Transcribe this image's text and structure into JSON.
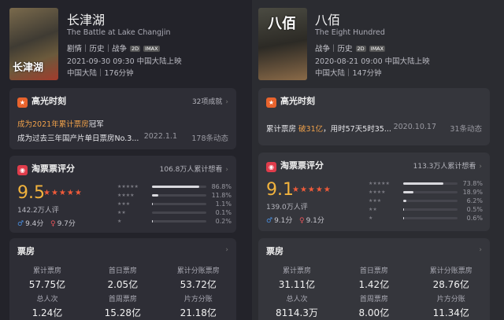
{
  "movies": [
    {
      "poster_title": "长津湖",
      "title": "长津湖",
      "title_en": "The Battle at Lake Changjin",
      "genre": "剧情｜历史｜战争",
      "format_tag": "2D",
      "imax": "IMAX",
      "release": "2021-09-30 09:30 中国大陆上映",
      "region": "中国大陆｜176分钟",
      "highlights": {
        "header": "高光时刻",
        "summary": "32项成就",
        "rows": [
          {
            "text_prefix": "成为",
            "text_hl": "2021年累计票房",
            "text_suffix": "冠军",
            "date": "",
            "count": ""
          },
          {
            "text_prefix": "成为过去三年国产片单日票房No.3...",
            "text_hl": "",
            "text_suffix": "",
            "date": "2022.1.1",
            "count": "178条动态"
          }
        ]
      },
      "rating": {
        "header": "淘票票评分",
        "want": "106.8万人累计想看",
        "score": "9.5",
        "stars": "★★★★★",
        "raters": "142.2万人评",
        "male_score": "9.4分",
        "female_score": "9.7分",
        "distribution": [
          {
            "stars": "★★★★★",
            "pct": "86.8%",
            "fraction": 0.868
          },
          {
            "stars": "★★★★",
            "pct": "11.8%",
            "fraction": 0.118
          },
          {
            "stars": "★★★",
            "pct": "1.1%",
            "fraction": 0.011
          },
          {
            "stars": "★★",
            "pct": "0.1%",
            "fraction": 0.001
          },
          {
            "stars": "★",
            "pct": "0.2%",
            "fraction": 0.002
          }
        ]
      },
      "box_office": {
        "header": "票房",
        "cells": [
          {
            "label": "累计票房",
            "value": "57.75亿"
          },
          {
            "label": "首日票房",
            "value": "2.05亿"
          },
          {
            "label": "累计分账票房",
            "value": "53.72亿"
          },
          {
            "label": "总人次",
            "value": "1.24亿"
          },
          {
            "label": "首周票房",
            "value": "15.28亿"
          },
          {
            "label": "片方分账",
            "value": "21.18亿"
          }
        ]
      }
    },
    {
      "poster_title": "八佰",
      "title": "八佰",
      "title_en": "The Eight Hundred",
      "genre": "战争｜历史",
      "format_tag": "2D",
      "imax": "IMAX",
      "release": "2020-08-21 09:00 中国大陆上映",
      "region": "中国大陆｜147分钟",
      "highlights": {
        "header": "高光时刻",
        "summary": "",
        "rows": [
          {
            "text_prefix": "累计票房 ",
            "text_hl": "破31亿",
            "text_suffix": "，用时57天5时35...",
            "date": "2020.10.17",
            "count": "31条动态"
          }
        ]
      },
      "rating": {
        "header": "淘票票评分",
        "want": "113.3万人累计想看",
        "score": "9.1",
        "stars": "★★★★★",
        "raters": "139.0万人评",
        "male_score": "9.1分",
        "female_score": "9.1分",
        "distribution": [
          {
            "stars": "★★★★★",
            "pct": "73.8%",
            "fraction": 0.738
          },
          {
            "stars": "★★★★",
            "pct": "18.9%",
            "fraction": 0.189
          },
          {
            "stars": "★★★",
            "pct": "6.2%",
            "fraction": 0.062
          },
          {
            "stars": "★★",
            "pct": "0.5%",
            "fraction": 0.005
          },
          {
            "stars": "★",
            "pct": "0.6%",
            "fraction": 0.006
          }
        ]
      },
      "box_office": {
        "header": "票房",
        "cells": [
          {
            "label": "累计票房",
            "value": "31.11亿"
          },
          {
            "label": "首日票房",
            "value": "1.42亿"
          },
          {
            "label": "累计分账票房",
            "value": "28.76亿"
          },
          {
            "label": "总人次",
            "value": "8114.3万"
          },
          {
            "label": "首周票房",
            "value": "8.00亿"
          },
          {
            "label": "片方分账",
            "value": "11.34亿"
          }
        ]
      }
    }
  ],
  "icons": {
    "highlight": "highlight-icon",
    "taopiao": "taopiao-logo-icon",
    "male": "male-icon",
    "female": "female-icon",
    "chevron": "chevron-right-icon"
  },
  "colors": {
    "accent_orange": "#f0a14a",
    "score_gold": "#f2b33d",
    "star_red": "#f05b3a"
  }
}
